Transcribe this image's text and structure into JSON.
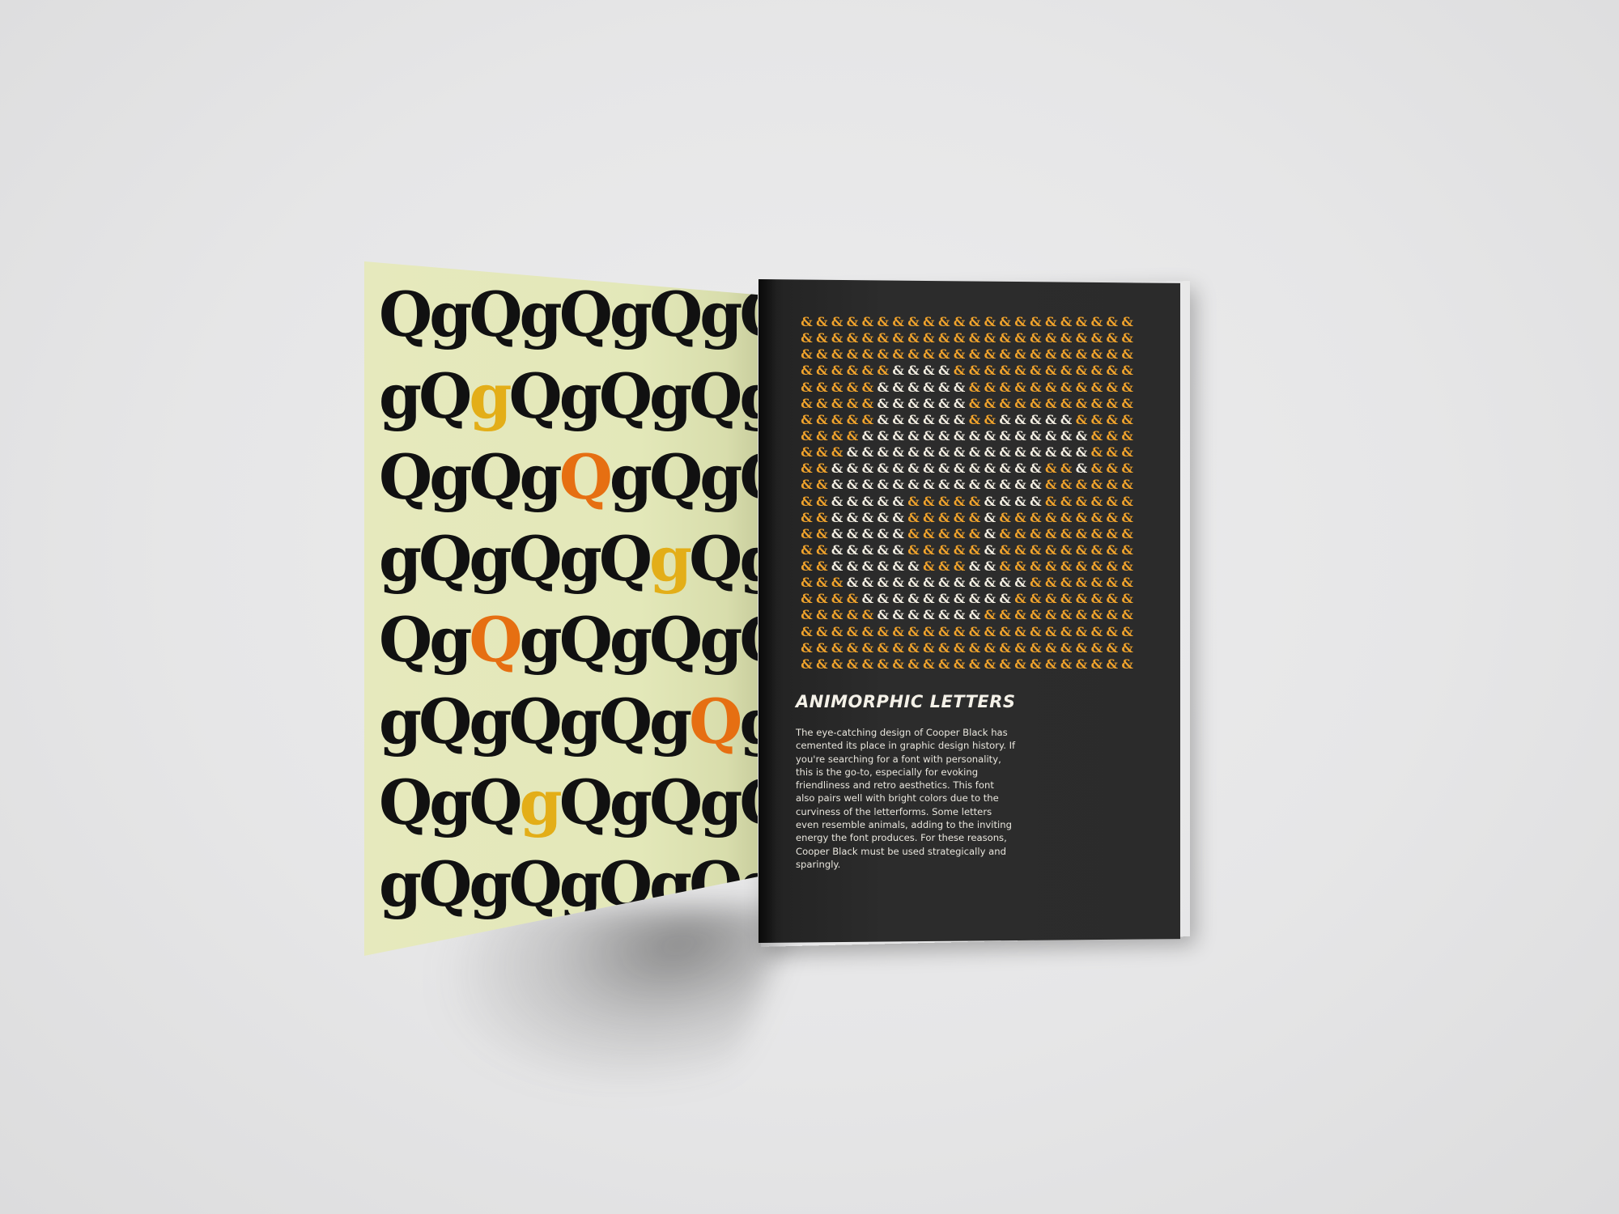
{
  "left_page": {
    "background": "#e4e8bb",
    "glyph_color": "#111111",
    "highlight_colors": {
      "yellow": "#e3ae18",
      "orange": "#e66f12"
    },
    "rows": [
      [
        {
          "c": "Q"
        },
        {
          "c": "g"
        },
        {
          "c": "Q"
        },
        {
          "c": "g"
        },
        {
          "c": "Q"
        },
        {
          "c": "g"
        },
        {
          "c": "Q"
        },
        {
          "c": "g"
        },
        {
          "c": "Q"
        }
      ],
      [
        {
          "c": "g"
        },
        {
          "c": "Q"
        },
        {
          "c": "g",
          "hl": "yellow"
        },
        {
          "c": "Q"
        },
        {
          "c": "g"
        },
        {
          "c": "Q"
        },
        {
          "c": "g"
        },
        {
          "c": "Q"
        },
        {
          "c": "g"
        }
      ],
      [
        {
          "c": "Q"
        },
        {
          "c": "g"
        },
        {
          "c": "Q"
        },
        {
          "c": "g"
        },
        {
          "c": "Q",
          "hl": "orange"
        },
        {
          "c": "g"
        },
        {
          "c": "Q"
        },
        {
          "c": "g"
        },
        {
          "c": "Q"
        }
      ],
      [
        {
          "c": "g"
        },
        {
          "c": "Q"
        },
        {
          "c": "g"
        },
        {
          "c": "Q"
        },
        {
          "c": "g"
        },
        {
          "c": "Q"
        },
        {
          "c": "g",
          "hl": "yellow"
        },
        {
          "c": "Q"
        },
        {
          "c": "g"
        }
      ],
      [
        {
          "c": "Q"
        },
        {
          "c": "g"
        },
        {
          "c": "Q",
          "hl": "orange"
        },
        {
          "c": "g"
        },
        {
          "c": "Q"
        },
        {
          "c": "g"
        },
        {
          "c": "Q"
        },
        {
          "c": "g"
        },
        {
          "c": "Q"
        }
      ],
      [
        {
          "c": "g"
        },
        {
          "c": "Q"
        },
        {
          "c": "g"
        },
        {
          "c": "Q"
        },
        {
          "c": "g"
        },
        {
          "c": "Q"
        },
        {
          "c": "g"
        },
        {
          "c": "Q",
          "hl": "orange"
        },
        {
          "c": "g"
        }
      ],
      [
        {
          "c": "Q"
        },
        {
          "c": "g"
        },
        {
          "c": "Q"
        },
        {
          "c": "g",
          "hl": "yellow"
        },
        {
          "c": "Q"
        },
        {
          "c": "g"
        },
        {
          "c": "Q"
        },
        {
          "c": "g"
        },
        {
          "c": "Q"
        }
      ],
      [
        {
          "c": "g"
        },
        {
          "c": "Q"
        },
        {
          "c": "g"
        },
        {
          "c": "Q"
        },
        {
          "c": "g"
        },
        {
          "c": "Q"
        },
        {
          "c": "g"
        },
        {
          "c": "Q"
        },
        {
          "c": "g"
        }
      ]
    ]
  },
  "right_page": {
    "background": "#2b2b2b",
    "pattern": {
      "glyph": "&",
      "color_main": "#f0a32c",
      "color_light": "#f3eee2",
      "columns": 22,
      "rows": 22
    },
    "title": "ANIMORPHIC LETTERS",
    "body": "The eye-catching design of Cooper Black has cemented its place in graphic design history. If you're searching for a font with personality, this is the go-to, especially for evoking friendliness and retro aesthetics. This font also pairs well with bright colors due to the curviness of the letterforms. Some letters even resemble animals, adding to the inviting energy the font produces. For these reasons, Cooper Black must be used strategically and sparingly."
  }
}
